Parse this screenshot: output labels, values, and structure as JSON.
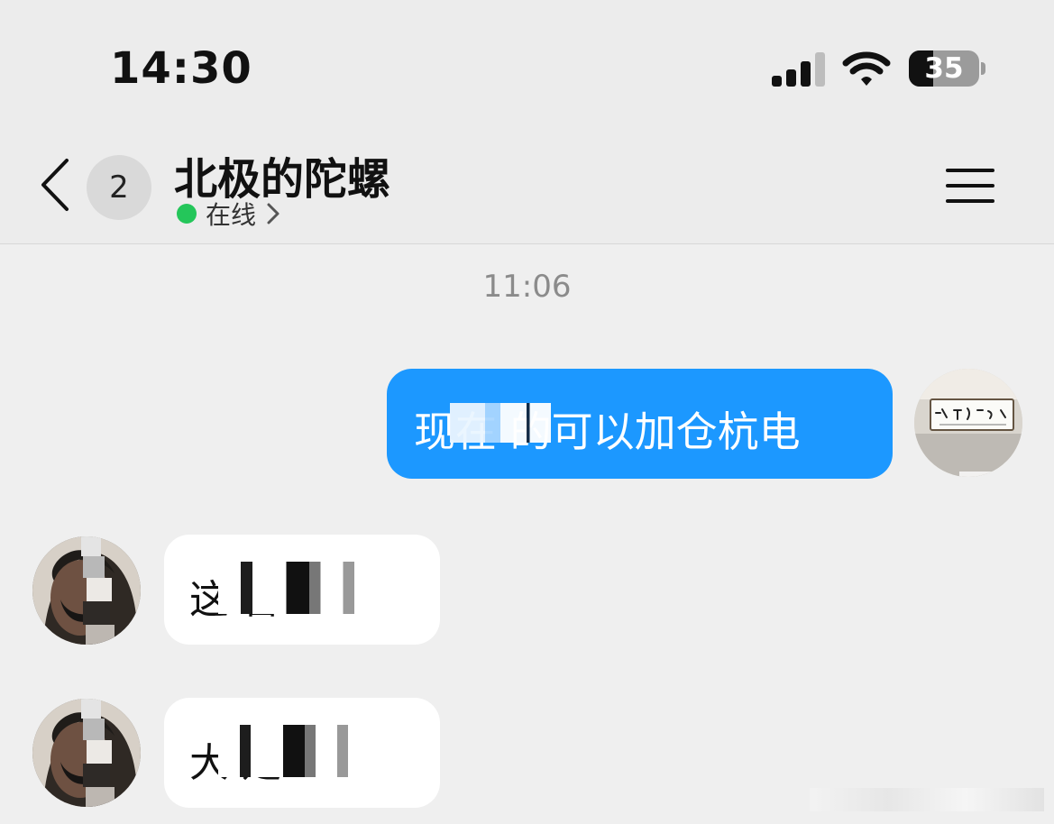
{
  "status_bar": {
    "time": "14:30",
    "battery": "35"
  },
  "header": {
    "unread_count": "2",
    "name": "北极的陀螺",
    "status": "在线"
  },
  "messages": {
    "timestamp": "11:06",
    "outgoing_1": "现在  的可以加仓杭电",
    "incoming_1": "这  言",
    "incoming_2": "大  走"
  },
  "colors": {
    "outgoing_bubble": "#1c98ff",
    "online_dot": "#24c65a"
  }
}
